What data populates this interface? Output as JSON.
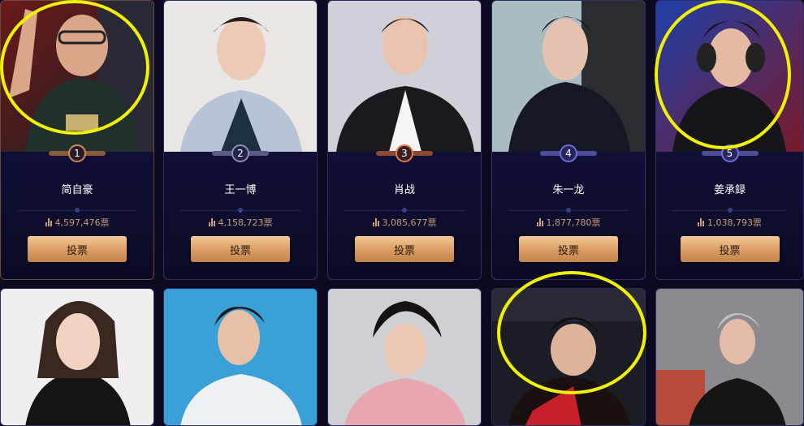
{
  "vote_icon": "bar-chart-icon",
  "highlight_color": "#f2f200",
  "accent_color": "#d99c61",
  "top_row": [
    {
      "rank": "1",
      "name": "简自豪",
      "votes": "4,597,476票",
      "button": "投票",
      "rank_color": "#c98a5c"
    },
    {
      "rank": "2",
      "name": "王一博",
      "votes": "4,158,723票",
      "button": "投票",
      "rank_color": "#8a8db8"
    },
    {
      "rank": "3",
      "name": "肖战",
      "votes": "3,085,677票",
      "button": "投票",
      "rank_color": "#e07b4d"
    },
    {
      "rank": "4",
      "name": "朱一龙",
      "votes": "1,877,780票",
      "button": "投票",
      "rank_color": "#6f6fd6"
    },
    {
      "rank": "5",
      "name": "姜承録",
      "votes": "1,038,793票",
      "button": "投票",
      "rank_color": "#6f6fd6"
    }
  ]
}
